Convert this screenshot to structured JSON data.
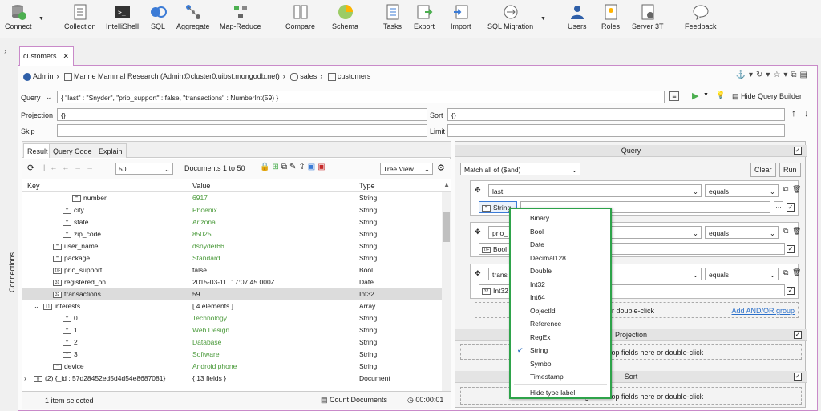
{
  "toolbar": {
    "items": [
      {
        "label": "Connect",
        "icon": "connect-icon"
      },
      {
        "label": "Collection",
        "icon": "collection-icon"
      },
      {
        "label": "IntelliShell",
        "icon": "intellishell-icon"
      },
      {
        "label": "SQL",
        "icon": "sql-icon"
      },
      {
        "label": "Aggregate",
        "icon": "aggregate-icon"
      },
      {
        "label": "Map-Reduce",
        "icon": "map-reduce-icon"
      },
      {
        "label": "Compare",
        "icon": "compare-icon"
      },
      {
        "label": "Schema",
        "icon": "schema-icon"
      },
      {
        "label": "Tasks",
        "icon": "tasks-icon"
      },
      {
        "label": "Export",
        "icon": "export-icon"
      },
      {
        "label": "Import",
        "icon": "import-icon"
      },
      {
        "label": "SQL Migration",
        "icon": "sql-migration-icon"
      },
      {
        "label": "Users",
        "icon": "users-icon"
      },
      {
        "label": "Roles",
        "icon": "roles-icon"
      },
      {
        "label": "Server 3T",
        "icon": "server-3t-icon"
      },
      {
        "label": "Feedback",
        "icon": "feedback-icon"
      }
    ]
  },
  "sidebar": {
    "label": "Connections"
  },
  "tab": {
    "label": "customers"
  },
  "breadcrumb": {
    "user": "Admin",
    "connection": "Marine Mammal Research (Admin@cluster0.uibst.mongodb.net)",
    "database": "sales",
    "collection": "customers"
  },
  "query": {
    "label": "Query",
    "value": "{ \"last\" : \"Snyder\", \"prio_support\" : false, \"transactions\" : NumberInt(59) }",
    "hide_builder": "Hide Query Builder",
    "projection_label": "Projection",
    "projection_value": "{}",
    "sort_label": "Sort",
    "sort_value": "{}",
    "skip_label": "Skip",
    "limit_label": "Limit"
  },
  "result_tabs": [
    "Result",
    "Query Code",
    "Explain"
  ],
  "result_toolbar": {
    "page_size": "50",
    "docs": "Documents 1 to 50",
    "view": "Tree View"
  },
  "tree": {
    "headers": {
      "key": "Key",
      "value": "Value",
      "type": "Type"
    },
    "rows": [
      {
        "key": "number",
        "value": "6917",
        "type": "String",
        "indent": 48,
        "green": true,
        "icon": "\"\""
      },
      {
        "key": "city",
        "value": "Phoenix",
        "type": "String",
        "indent": 36,
        "green": true,
        "icon": "\"\""
      },
      {
        "key": "state",
        "value": "Arizona",
        "type": "String",
        "indent": 36,
        "green": true,
        "icon": "\"\""
      },
      {
        "key": "zip_code",
        "value": "85025",
        "type": "String",
        "indent": 36,
        "green": true,
        "icon": "\"\""
      },
      {
        "key": "user_name",
        "value": "dsnyder66",
        "type": "String",
        "indent": 24,
        "green": true,
        "icon": "\"\""
      },
      {
        "key": "package",
        "value": "Standard",
        "type": "String",
        "indent": 24,
        "green": true,
        "icon": "\"\""
      },
      {
        "key": "prio_support",
        "value": "false",
        "type": "Bool",
        "indent": 24,
        "green": false,
        "icon": "T/F"
      },
      {
        "key": "registered_on",
        "value": "2015-03-11T17:07:45.000Z",
        "type": "Date",
        "indent": 24,
        "green": false,
        "icon": "31"
      },
      {
        "key": "transactions",
        "value": "59",
        "type": "Int32",
        "indent": 24,
        "green": false,
        "icon": "32",
        "selected": true
      },
      {
        "key": "interests",
        "value": "[ 4 elements ]",
        "type": "Array",
        "indent": 12,
        "green": false,
        "icon": "[ ]",
        "expander": "⌄"
      },
      {
        "key": "0",
        "value": "Technology",
        "type": "String",
        "indent": 36,
        "green": true,
        "icon": "\"\""
      },
      {
        "key": "1",
        "value": "Web Design",
        "type": "String",
        "indent": 36,
        "green": true,
        "icon": "\"\""
      },
      {
        "key": "2",
        "value": "Database",
        "type": "String",
        "indent": 36,
        "green": true,
        "icon": "\"\""
      },
      {
        "key": "3",
        "value": "Software",
        "type": "String",
        "indent": 36,
        "green": true,
        "icon": "\"\""
      },
      {
        "key": "device",
        "value": "Android phone",
        "type": "String",
        "indent": 24,
        "green": true,
        "icon": "\"\""
      },
      {
        "key": "(2) {_id : 57d28452ed5d4d54e8687081}",
        "value": "{ 13 fields }",
        "type": "Document",
        "indent": 0,
        "green": false,
        "icon": "{}",
        "expander": "›"
      }
    ]
  },
  "status": {
    "selected": "1 item selected",
    "count": "Count Documents",
    "time": "00:00:01"
  },
  "builder": {
    "query_title": "Query",
    "match": "Match all of ($and)",
    "clear": "Clear",
    "run": "Run",
    "conditions": [
      {
        "field": "last",
        "op": "equals",
        "type": "String"
      },
      {
        "field": "prio_",
        "op": "equals",
        "type": "Bool"
      },
      {
        "field": "trans",
        "op": "equals",
        "type": "Int32"
      }
    ],
    "drop_hint": "r double-click",
    "add_group": "Add AND/OR group",
    "projection_title": "Projection",
    "projection_hint": "Drag and drop fields here or double-click",
    "sort_title": "Sort",
    "sort_hint": "Drag and drop fields here or double-click"
  },
  "type_menu": {
    "items": [
      "Binary",
      "Bool",
      "Date",
      "Decimal128",
      "Double",
      "Int32",
      "Int64",
      "ObjectId",
      "Reference",
      "RegEx",
      "String",
      "Symbol",
      "Timestamp"
    ],
    "checked": "String",
    "footer": "Hide type label"
  }
}
